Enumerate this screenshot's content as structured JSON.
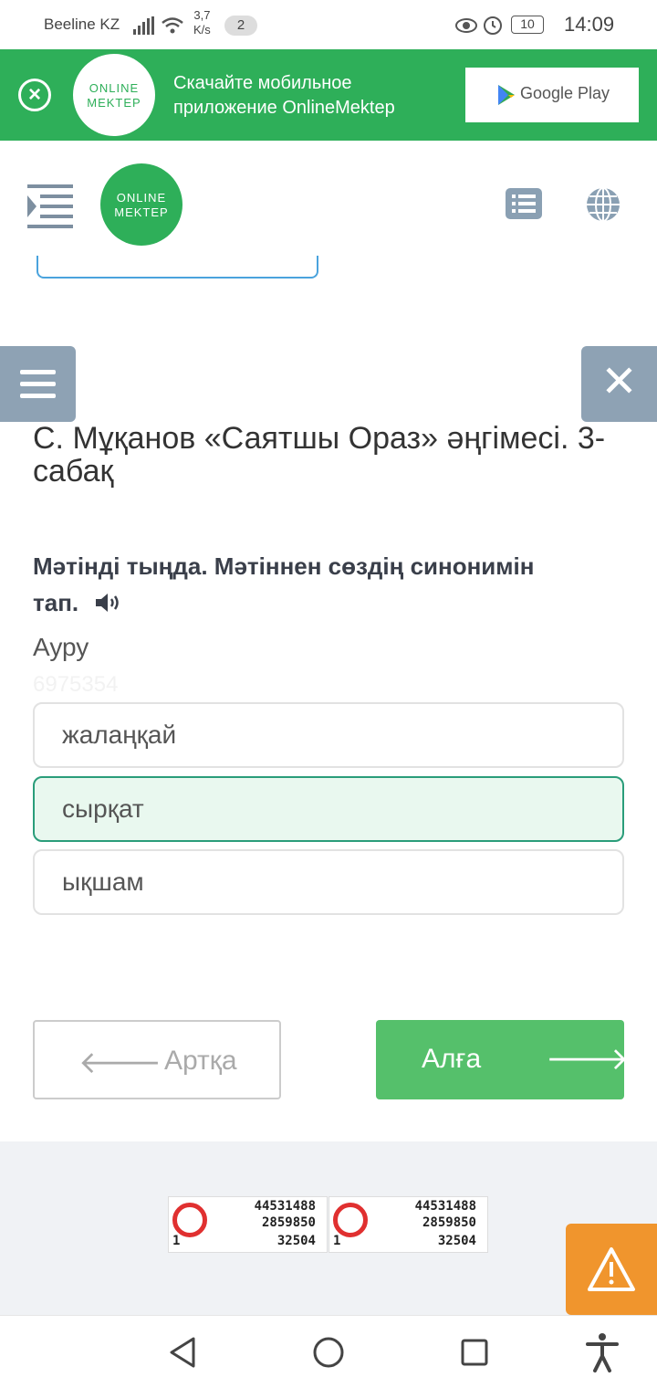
{
  "status_bar": {
    "carrier": "Beeline KZ",
    "speed_value": "3,7",
    "speed_unit": "K/s",
    "notification_count": "2",
    "battery": "10",
    "time": "14:09"
  },
  "app_banner": {
    "logo_line1": "ONLINE",
    "logo_line2": "MEKTEP",
    "text": "Скачайте мобильное приложение OnlineMektep",
    "store_label": "Google Play"
  },
  "header": {
    "logo_line1": "ONLINE",
    "logo_line2": "MEKTEP"
  },
  "lesson": {
    "title": "С. Мұқанов «Саятшы Ораз» әңгімесі. 3-сабақ",
    "question": "Мәтінді тыңда. Мәтіннен сөздің синонимін тап.",
    "word": "Ауру",
    "watermark": "6975354",
    "options": [
      {
        "label": "жалаңқай",
        "selected": false
      },
      {
        "label": "сырқат",
        "selected": true
      },
      {
        "label": "ықшам",
        "selected": false
      }
    ]
  },
  "navigation": {
    "back_label": "Артқа",
    "next_label": "Алға"
  },
  "counters": [
    {
      "total": "44531488",
      "second": "2859850",
      "third": "32504",
      "left": "1"
    },
    {
      "total": "44531488",
      "second": "2859850",
      "third": "32504",
      "left": "1"
    }
  ],
  "colors": {
    "brand_green": "#2eaf59",
    "button_green": "#55c06b",
    "side_tab": "#8ea2b4",
    "report": "#f0952d"
  }
}
